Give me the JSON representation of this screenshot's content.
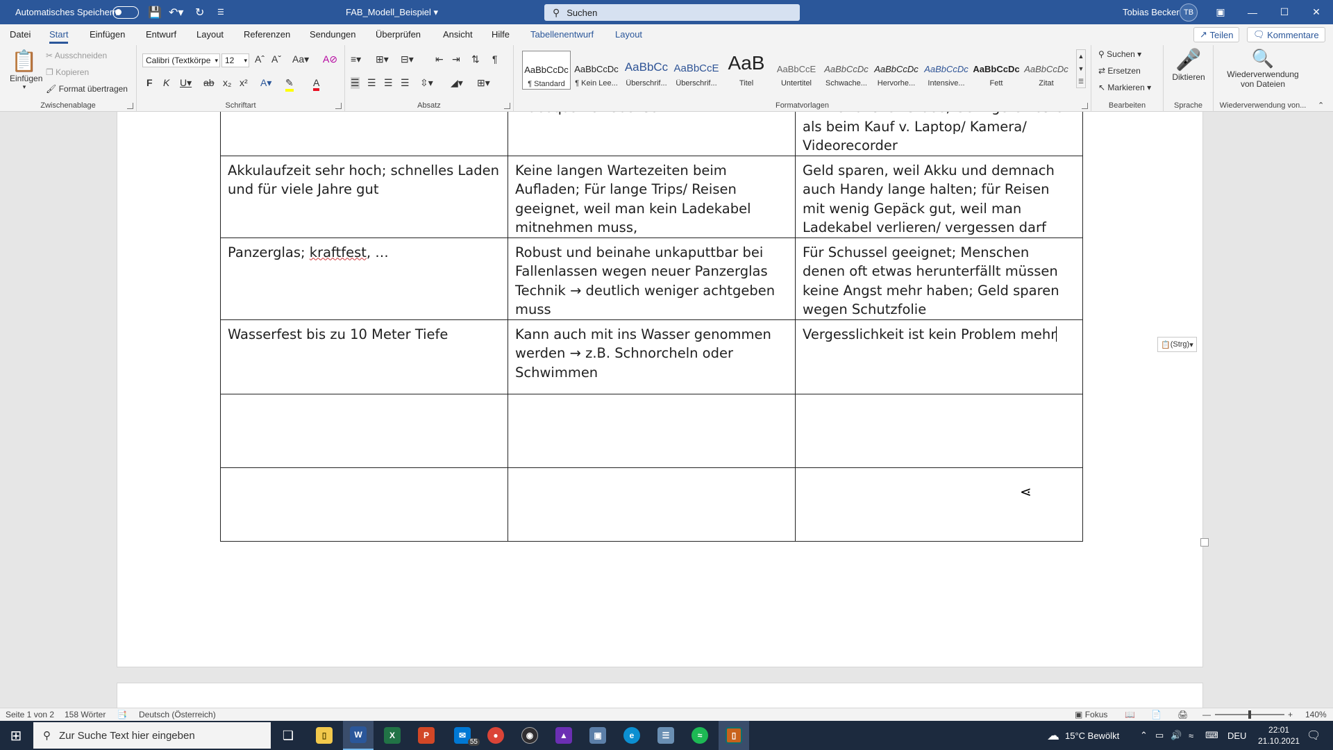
{
  "titlebar": {
    "autosave_label": "Automatisches Speichern",
    "doc_title": "FAB_Modell_Beispiel",
    "search_placeholder": "Suchen",
    "user_name": "Tobias Becker",
    "user_initials": "TB"
  },
  "tabs": [
    "Datei",
    "Start",
    "Einfügen",
    "Entwurf",
    "Layout",
    "Referenzen",
    "Sendungen",
    "Überprüfen",
    "Ansicht",
    "Hilfe",
    "Tabellenentwurf",
    "Layout"
  ],
  "share": {
    "share_label": "Teilen",
    "comments_label": "Kommentare"
  },
  "ribbon": {
    "clipboard": {
      "paste_label": "Einfügen",
      "cut_label": "Ausschneiden",
      "copy_label": "Kopieren",
      "format_painter_label": "Format übertragen",
      "group_label": "Zwischenablage"
    },
    "font": {
      "font_name": "Calibri (Textkörpe",
      "font_size": "12",
      "group_label": "Schriftart"
    },
    "paragraph": {
      "group_label": "Absatz"
    },
    "styles": {
      "group_label": "Formatvorlagen",
      "items": [
        {
          "sample": "AaBbCcDc",
          "name": "¶ Standard"
        },
        {
          "sample": "AaBbCcDc",
          "name": "¶ Kein Lee..."
        },
        {
          "sample": "AaBbCc",
          "name": "Überschrif..."
        },
        {
          "sample": "AaBbCcE",
          "name": "Überschrif..."
        },
        {
          "sample": "AaB",
          "name": "Titel"
        },
        {
          "sample": "AaBbCcE",
          "name": "Untertitel"
        },
        {
          "sample": "AaBbCcDc",
          "name": "Schwache..."
        },
        {
          "sample": "AaBbCcDc",
          "name": "Hervorhe..."
        },
        {
          "sample": "AaBbCcDc",
          "name": "Intensive..."
        },
        {
          "sample": "AaBbCcDc",
          "name": "Fett"
        },
        {
          "sample": "AaBbCcDc",
          "name": "Zitat"
        }
      ]
    },
    "editing": {
      "find_label": "Suchen",
      "replace_label": "Ersetzen",
      "select_label": "Markieren",
      "group_label": "Bearbeiten"
    },
    "voice": {
      "dictate_label": "Diktieren",
      "group_label": "Sprache"
    },
    "reuse": {
      "reuse_label": "Wiederverwendung von Dateien",
      "group_label": "Wiederverwendung von..."
    }
  },
  "table": {
    "rows": [
      [
        "",
        "Videoqualität ebenso",
        "mit handlicher Größe; Geringere Kosten als beim Kauf v. Laptop/ Kamera/ Videorecorder"
      ],
      [
        "Akkulaufzeit sehr hoch; schnelles Laden und für viele Jahre gut",
        "Keine langen Wartezeiten beim Aufladen; Für lange Trips/ Reisen geeignet, weil man kein Ladekabel mitnehmen muss,",
        "Geld sparen, weil Akku und demnach auch Handy lange halten; für Reisen mit wenig Gepäck gut, weil man Ladekabel verlieren/ vergessen darf"
      ],
      [
        "Panzerglas; kraftfest, …",
        "Robust und beinahe unkaputtbar bei Fallenlassen wegen neuer Panzerglas Technik → deutlich weniger achtgeben muss",
        "Für Schussel geeignet; Menschen denen oft etwas herunterfällt müssen keine Angst mehr haben; Geld sparen wegen Schutzfolie"
      ],
      [
        "Wasserfest bis zu 10 Meter Tiefe",
        "Kann auch mit ins Wasser genommen werden → z.B. Schnorcheln oder Schwimmen",
        "Vergesslichkeit ist kein Problem mehr"
      ],
      [
        "",
        "",
        ""
      ],
      [
        "",
        "",
        ""
      ]
    ],
    "panzer_prefix": "Panzerglas; ",
    "panzer_misspelled": "kraftfest",
    "panzer_suffix": ", …",
    "paste_options": "(Strg)"
  },
  "statusbar": {
    "page_info": "Seite 1 von 2",
    "word_count": "158 Wörter",
    "language": "Deutsch (Österreich)",
    "focus_label": "Fokus",
    "zoom": "140%"
  },
  "taskbar": {
    "search_placeholder": "Zur Suche Text hier eingeben",
    "mail_badge": "55",
    "weather": "15°C  Bewölkt",
    "lang": "DEU",
    "time": "22:01",
    "date": "21.10.2021"
  }
}
